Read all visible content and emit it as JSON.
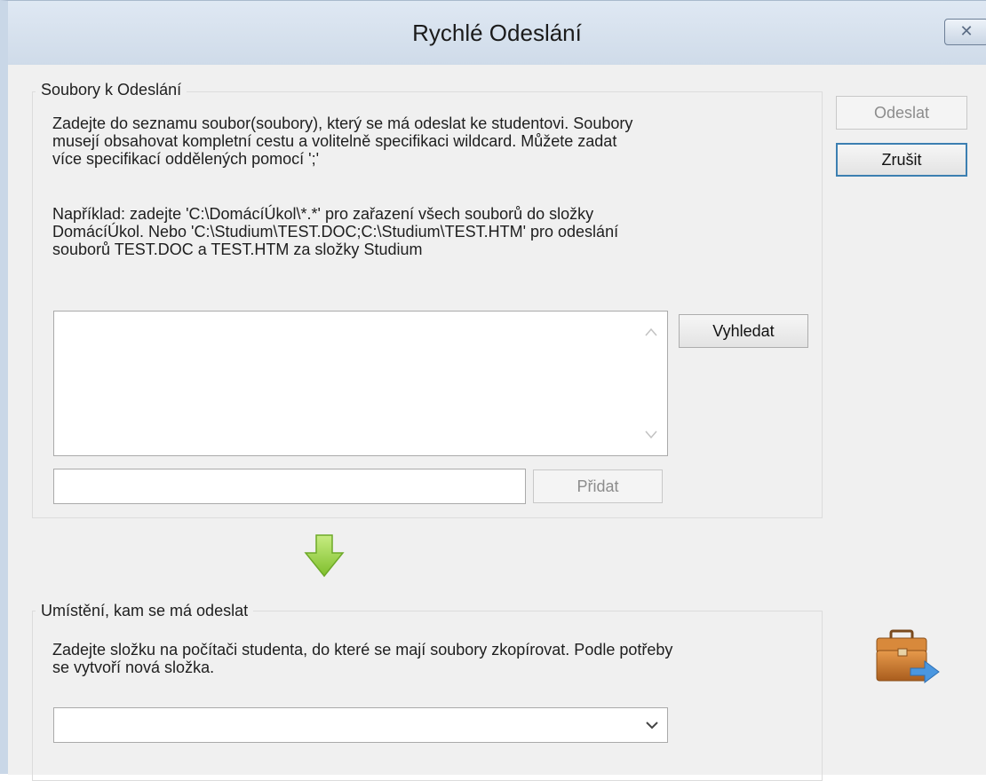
{
  "window": {
    "title": "Rychlé Odeslání",
    "close_glyph": "✕"
  },
  "files_group": {
    "legend": "Soubory k Odeslání",
    "description": [
      "Zadejte do seznamu soubor(soubory), který se má odeslat ke studentovi. Soubory",
      "musejí obsahovat kompletní cestu a volitelně specifikaci wildcard. Můžete zadat",
      "více specifikací oddělených pomocí ';'"
    ],
    "example": [
      "Například: zadejte 'C:\\DomácíÚkol\\*.*' pro zařazení všech souborů do složky",
      "DomácíÚkol. Nebo 'C:\\Studium\\TEST.DOC;C:\\Studium\\TEST.HTM' pro odeslání",
      "souborů TEST.DOC a TEST.HTM za složky Studium"
    ],
    "file_list": [],
    "browse_label": "Vyhledat",
    "add_input_value": "",
    "add_label": "Přidat"
  },
  "buttons": {
    "send_label": "Odeslat",
    "cancel_label": "Zrušit"
  },
  "destination_group": {
    "legend": "Umístění, kam se má odeslat",
    "description": [
      "Zadejte složku na počítači studenta, do které se mají soubory zkopírovat. Podle potřeby",
      "se vytvoří nová složka."
    ],
    "selected_folder": ""
  },
  "icons": {
    "arrow": "down-arrow-icon",
    "briefcase": "briefcase-send-icon"
  },
  "colors": {
    "arrow_green": "#8cc63f",
    "briefcase_orange": "#c9772a",
    "send_arrow_blue": "#3f87d6"
  }
}
